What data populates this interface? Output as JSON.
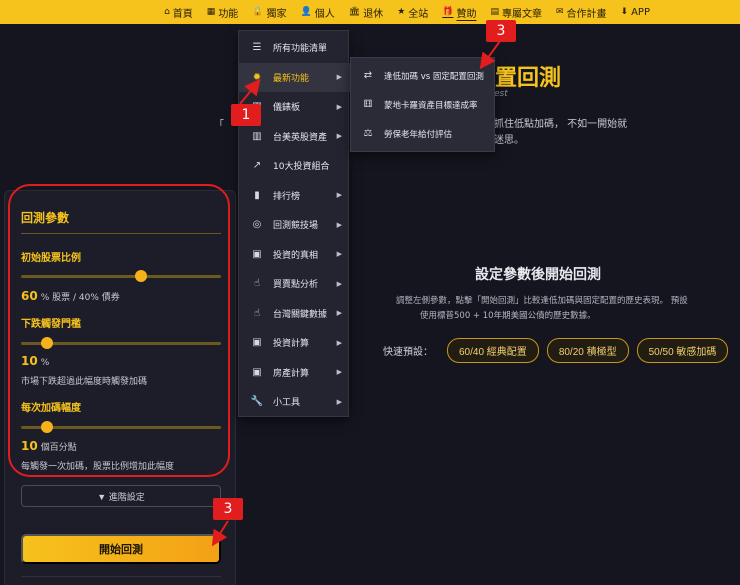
{
  "nav": {
    "items": [
      {
        "icon": "home-icon",
        "glyph": "⌂",
        "label": "首頁"
      },
      {
        "icon": "grid-icon",
        "glyph": "▦",
        "label": "功能"
      },
      {
        "icon": "lock-icon",
        "glyph": "🔒",
        "label": "獨家"
      },
      {
        "icon": "user-icon",
        "glyph": "👤",
        "label": "個人"
      },
      {
        "icon": "bank-icon",
        "glyph": "🏛",
        "label": "退休"
      },
      {
        "icon": "star-icon",
        "glyph": "★",
        "label": "全站"
      },
      {
        "icon": "gift-icon",
        "glyph": "🎁",
        "label": "贊助"
      },
      {
        "icon": "document-icon",
        "glyph": "▤",
        "label": "專屬文章"
      },
      {
        "icon": "handshake-icon",
        "glyph": "✉",
        "label": "合作計畫"
      },
      {
        "icon": "download-icon",
        "glyph": "⬇",
        "label": "APP"
      }
    ]
  },
  "hero": {
    "title": "置回測",
    "subtitle": "est",
    "line1": "抓住低點加碼， 不如一開始就",
    "line2": "迷思。",
    "quote": "「"
  },
  "menu": {
    "items": [
      {
        "name": "all-features",
        "icon": "list-icon",
        "glyph": "☰",
        "label": "所有功能清單",
        "arrow": ""
      },
      {
        "name": "new-features",
        "icon": "gear-icon",
        "glyph": "✹",
        "label": "最新功能",
        "arrow": "▶"
      },
      {
        "name": "dashboard",
        "icon": "dashboard-icon",
        "glyph": "▦",
        "label": "儀錶板",
        "arrow": "▶"
      },
      {
        "name": "tw-us-assets",
        "icon": "chart-icon",
        "glyph": "▥",
        "label": "台美英股資產",
        "arrow": "▶"
      },
      {
        "name": "top10-portfolio",
        "icon": "trend-icon",
        "glyph": "↗",
        "label": "10大投資組合",
        "arrow": ""
      },
      {
        "name": "ranking",
        "icon": "bar-chart-icon",
        "glyph": "▮",
        "label": "排行榜",
        "arrow": "▶"
      },
      {
        "name": "backtest-arena",
        "icon": "target-icon",
        "glyph": "◎",
        "label": "回測競技場",
        "arrow": "▶"
      },
      {
        "name": "investing-truth",
        "icon": "calculator-icon",
        "glyph": "▣",
        "label": "投資的真相",
        "arrow": "▶"
      },
      {
        "name": "trade-point",
        "icon": "pointer-icon",
        "glyph": "☝",
        "label": "買賣點分析",
        "arrow": "▶"
      },
      {
        "name": "tw-key-data",
        "icon": "pointer-icon",
        "glyph": "☝",
        "label": "台灣關鍵數據",
        "arrow": "▶"
      },
      {
        "name": "invest-calc",
        "icon": "calculator-icon",
        "glyph": "▣",
        "label": "投資計算",
        "arrow": "▶"
      },
      {
        "name": "property-calc",
        "icon": "calculator-icon",
        "glyph": "▣",
        "label": "房產計算",
        "arrow": "▶"
      },
      {
        "name": "tools",
        "icon": "wrench-icon",
        "glyph": "🔧",
        "label": "小工具",
        "arrow": "▶"
      }
    ]
  },
  "submenu": {
    "items": [
      {
        "name": "dip-vs-fixed",
        "icon": "swap-icon",
        "glyph": "⇄",
        "label": "逢低加碼 vs 固定配置回測"
      },
      {
        "name": "monte-carlo",
        "icon": "dice-icon",
        "glyph": "⚅",
        "label": "蒙地卡羅資產目標達成率"
      },
      {
        "name": "labor-pension",
        "icon": "scale-icon",
        "glyph": "⚖",
        "label": "勞保老年給付評估"
      }
    ]
  },
  "panel": {
    "title": "回測參數",
    "stock_ratio": {
      "label": "初始股票比例",
      "value": "60",
      "unit": "% 股票 / 40% 債券",
      "fraction": 0.6
    },
    "drop_trigger": {
      "label": "下跌觸發門檻",
      "value": "10",
      "unit": "%",
      "desc": "市場下跌超過此幅度時觸發加碼",
      "fraction": 0.13
    },
    "add_step": {
      "label": "每次加碼幅度",
      "value": "10",
      "unit": "個百分點",
      "desc": "每觸發一次加碼，股票比例增加此幅度",
      "fraction": 0.13
    },
    "advanced_label": "▼ 進階設定",
    "start_label": "開始回測"
  },
  "empty": {
    "title": "設定參數後開始回測",
    "desc1": "調整左側參數，點擊「開始回測」比較逢低加碼與固定配置的歷史表現。 預設",
    "desc2": "使用標普500 + 10年期美國公債的歷史數據。",
    "presets_label": "快速預設：",
    "presets": [
      "60/40 經典配置",
      "80/20 積極型",
      "50/50 敏感加碼"
    ]
  },
  "callouts": {
    "one": "1",
    "three_a": "3",
    "three_b": "3"
  },
  "colors": {
    "accent": "#f6c21c",
    "callout": "#e21d1d",
    "background": "#14151e"
  }
}
